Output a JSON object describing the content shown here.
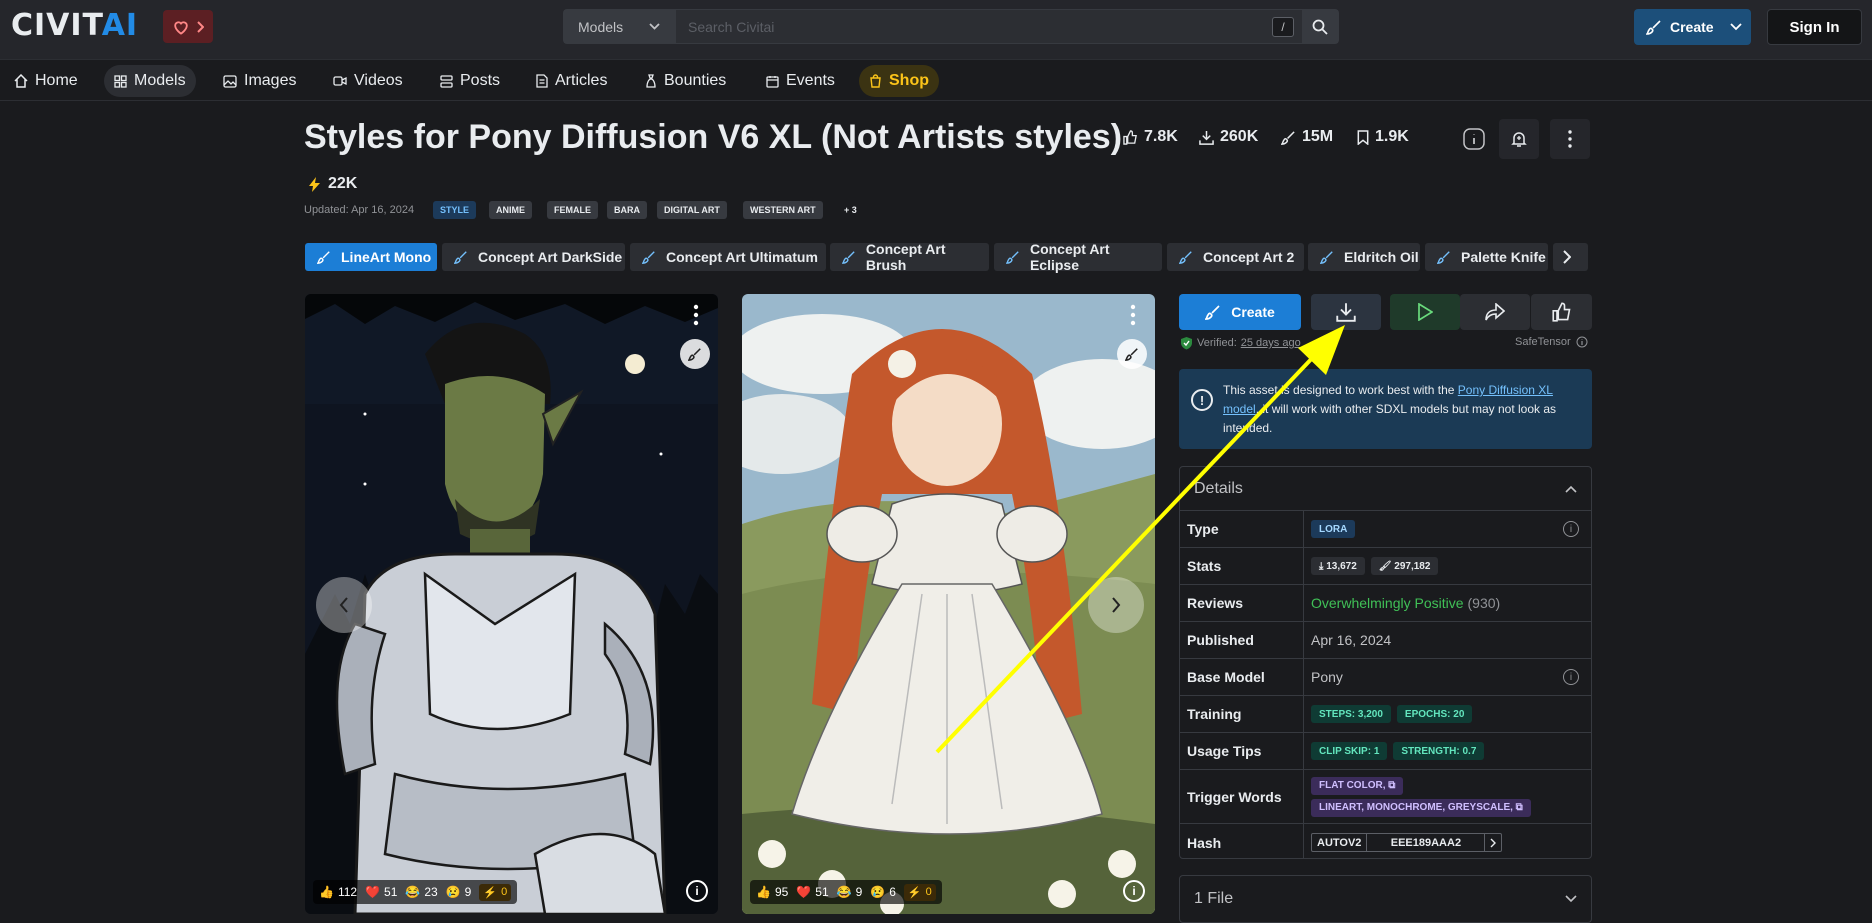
{
  "header": {
    "logo": "CIVITAI",
    "search_scope": "Models",
    "search_placeholder": "Search Civitai",
    "slash": "/",
    "create_label": "Create",
    "signin_label": "Sign In"
  },
  "nav": [
    {
      "label": "Home",
      "icon": "home-icon"
    },
    {
      "label": "Models",
      "icon": "grid-icon"
    },
    {
      "label": "Images",
      "icon": "image-icon"
    },
    {
      "label": "Videos",
      "icon": "video-icon"
    },
    {
      "label": "Posts",
      "icon": "posts-icon"
    },
    {
      "label": "Articles",
      "icon": "article-icon"
    },
    {
      "label": "Bounties",
      "icon": "bounty-icon"
    },
    {
      "label": "Events",
      "icon": "calendar-icon"
    },
    {
      "label": "Shop",
      "icon": "shop-icon"
    }
  ],
  "model": {
    "title": "Styles for Pony Diffusion V6 XL (Not Artists styles)",
    "likes": "7.8K",
    "downloads": "260K",
    "generations": "15M",
    "bookmarks": "1.9K",
    "buzz": "22K",
    "updated": "Updated: Apr 16, 2024",
    "tags": [
      "STYLE",
      "ANIME",
      "FEMALE",
      "BARA",
      "DIGITAL ART",
      "WESTERN ART",
      "+ 3"
    ]
  },
  "versions": [
    "LineArt Mono",
    "Concept Art DarkSide",
    "Concept Art Ultimatum",
    "Concept Art Brush",
    "Concept Art Eclipse",
    "Concept Art 2",
    "Eldritch Oil",
    "Palette Knife"
  ],
  "gallery": [
    {
      "likes": "112",
      "hearts": "51",
      "laughs": "23",
      "cries": "9",
      "buzz": "0"
    },
    {
      "likes": "95",
      "hearts": "51",
      "laughs": "9",
      "cries": "6",
      "buzz": "0"
    }
  ],
  "actions": {
    "create_label": "Create",
    "verified_label": "Verified:",
    "verified_time": "25 days ago",
    "safetensor": "SafeTensor"
  },
  "alert": {
    "text_before": "This asset is designed to work best with the ",
    "link": "Pony Diffusion XL model",
    "text_after": ", it will work with other SDXL models but may not look as intended."
  },
  "details": {
    "heading": "Details",
    "type_label": "Type",
    "type_value": "LORA",
    "stats_label": "Stats",
    "stats_downloads": "13,672",
    "stats_generations": "297,182",
    "reviews_label": "Reviews",
    "reviews_value": "Overwhelmingly Positive",
    "reviews_count": "(930)",
    "published_label": "Published",
    "published_value": "Apr 16, 2024",
    "base_label": "Base Model",
    "base_value": "Pony",
    "training_label": "Training",
    "training_steps": "STEPS: 3,200",
    "training_epochs": "EPOCHS: 20",
    "usage_label": "Usage Tips",
    "usage_clip": "CLIP SKIP: 1",
    "usage_strength": "STRENGTH: 0.7",
    "trigger_label": "Trigger Words",
    "trigger_1": "FLAT COLOR,",
    "trigger_2": "LINEART, MONOCHROME, GREYSCALE,",
    "hash_label": "Hash",
    "hash_type": "AUTOV2",
    "hash_value": "EEE189AAA2"
  },
  "files": {
    "label": "1 File"
  },
  "colors": {
    "accent": "#1c7ed6",
    "bg": "#1a1b1e",
    "panel": "#25262b",
    "annotation": "#ffff00",
    "positive": "#40c057"
  }
}
